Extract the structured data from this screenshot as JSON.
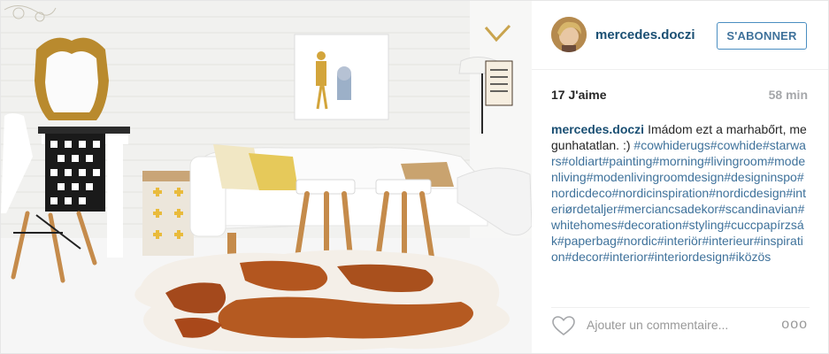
{
  "post": {
    "username": "mercedes.doczi",
    "follow_label": "S'ABONNER",
    "likes": "17 J'aime",
    "time": "58 min",
    "caption_author": "mercedes.doczi",
    "caption_text": "Imádom ezt a marhabőrt, megunhatatlan. :)",
    "caption_hashtags": "#cowhiderugs#cowhide#starwars#oldiart#painting#morning#livingroom#modenliving#modenlivingroomdesign#designinspo#nordicdeco#nordicinspiration#nordicdesign#interiørdetaljer#merciancsadekor#scandinavian#whitehomes#decoration#styling#cuccpapírzsák#paperbag#nordic#interiör#interieur#inspiration#decor#interior#interiordesign#iközös",
    "comment_placeholder": "Ajouter un commentaire...",
    "more_label": "ooo"
  },
  "icons": {
    "like": "heart-outline-icon",
    "more": "more-options-icon"
  },
  "colors": {
    "username": "#1a4f73",
    "hashtag": "#3f729b",
    "follow_border": "#4a8ec1",
    "muted": "#a5a7aa"
  }
}
